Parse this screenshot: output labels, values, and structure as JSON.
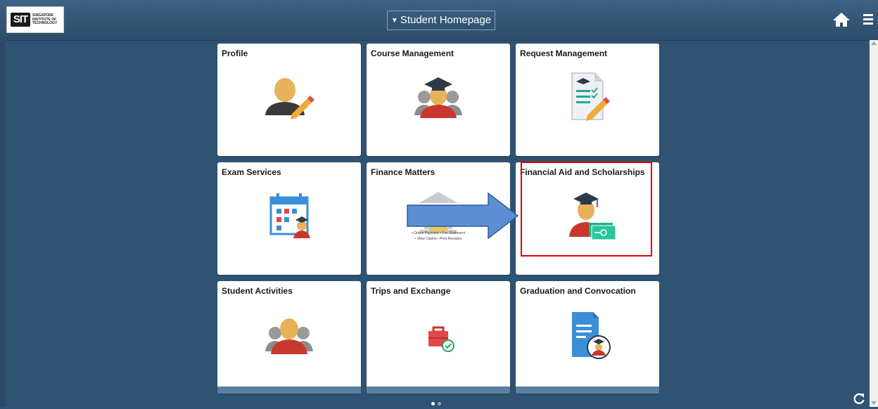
{
  "header": {
    "logo_mark": "SIT",
    "logo_text_lines": [
      "SINGAPORE",
      "INSTITUTE OF",
      "TECHNOLOGY"
    ],
    "page_title": "Student Homepage",
    "home_icon": "home-icon",
    "menu_icon": "hamburger-menu-icon"
  },
  "tiles": [
    {
      "title": "Profile",
      "icon": "profile-edit-icon"
    },
    {
      "title": "Course Management",
      "icon": "graduate-group-icon"
    },
    {
      "title": "Request Management",
      "icon": "request-document-icon"
    },
    {
      "title": "Exam Services",
      "icon": "calendar-graduate-icon"
    },
    {
      "title": "Finance Matters",
      "icon": "bank-icon",
      "lines": [
        "• Online Payment • Fee Statement",
        "• View Claims • Print Receipts"
      ]
    },
    {
      "title": "Financial Aid and Scholarships",
      "icon": "graduate-money-icon"
    },
    {
      "title": "Student Activities",
      "icon": "people-group-icon"
    },
    {
      "title": "Trips and Exchange",
      "icon": "suitcase-check-icon"
    },
    {
      "title": "Graduation and Convocation",
      "icon": "certificate-graduate-icon"
    }
  ],
  "pagination": {
    "total": 2,
    "active": 1
  },
  "colors": {
    "background": "#2f5373",
    "header": "#34587a",
    "highlight": "#e00000",
    "arrow": "#5b8ed2"
  }
}
